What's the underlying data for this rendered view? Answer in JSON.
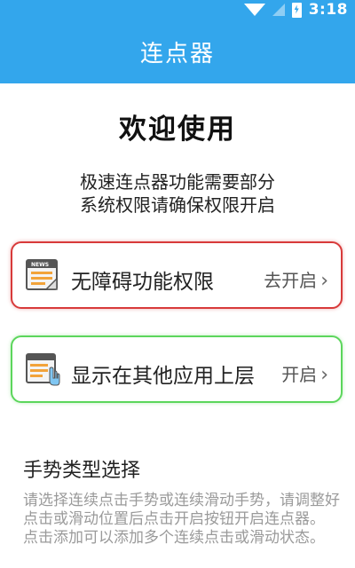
{
  "status_bar": {
    "time": "3:18"
  },
  "header": {
    "title": "连点器"
  },
  "welcome": "欢迎使用",
  "description": [
    "极速连点器功能需要部分",
    "系统权限请确保权限开启"
  ],
  "cards": [
    {
      "label": "无障碍功能权限",
      "action": "去开启",
      "icon": "news-icon",
      "border_color": "#d83a3a"
    },
    {
      "label": "显示在其他应用上层",
      "action": "开启",
      "icon": "window-hand-icon",
      "border_color": "#5cd65c"
    }
  ],
  "gesture": {
    "title": "手势类型选择",
    "hint_lines": [
      "请选择连续点击手势或连续滑动手势，请调整好",
      "点击或滑动位置后点击开启按钮开启连点器。",
      "点击添加可以添加多个连续点击或滑动状态。"
    ]
  },
  "colors": {
    "header": "#33a6ec",
    "chevron": "›"
  }
}
